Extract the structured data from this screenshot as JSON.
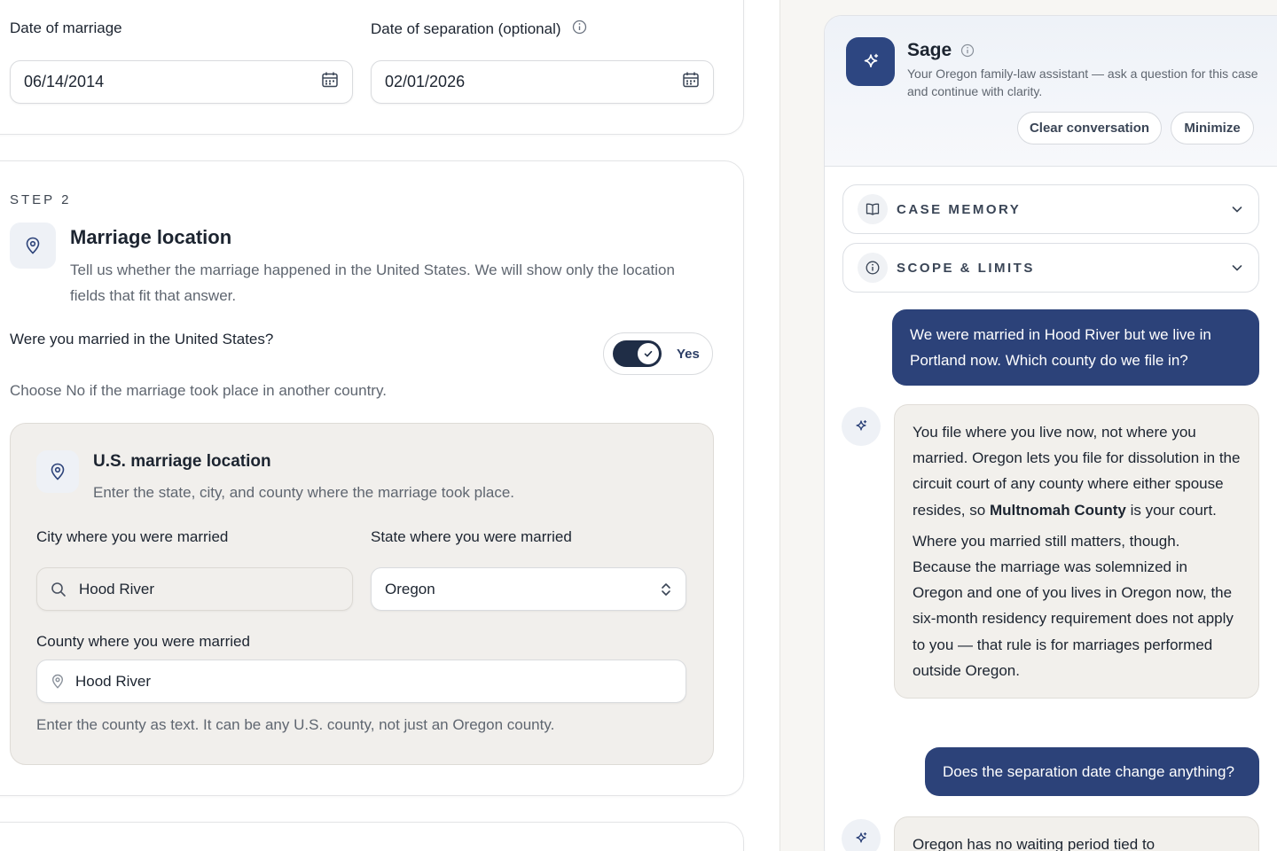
{
  "dates": {
    "marriage_label": "Date of marriage",
    "marriage_value": "06/14/2014",
    "separation_label": "Date of separation (optional)",
    "separation_value": "02/01/2026"
  },
  "step2": {
    "eyebrow": "STEP 2",
    "title": "Marriage location",
    "description": "Tell us whether the marriage happened in the United States. We will show only the location fields that fit that answer.",
    "question": "Were you married in the United States?",
    "toggle_label": "Yes",
    "toggle_on": true,
    "hint": "Choose No if the marriage took place in another country."
  },
  "us_location": {
    "title": "U.S. marriage location",
    "description": "Enter the state, city, and county where the marriage took place.",
    "city_label": "City where you were married",
    "city_value": "Hood River",
    "state_label": "State where you were married",
    "state_value": "Oregon",
    "county_label": "County where you were married",
    "county_value": "Hood River",
    "county_hint": "Enter the county as text. It can be any U.S. county, not just an Oregon county."
  },
  "assistant": {
    "name": "Sage",
    "subtitle": "Your Oregon family-law assistant — ask a question for this case and continue with clarity.",
    "clear_label": "Clear conversation",
    "minimize_label": "Minimize",
    "accordions": [
      {
        "label": "CASE MEMORY",
        "icon": "book-icon"
      },
      {
        "label": "SCOPE & LIMITS",
        "icon": "info-icon"
      }
    ],
    "messages": {
      "user1": "We were married in Hood River but we live in Portland now. Which county do we file in?",
      "ai1_p1_pre": "You file where you live now, not where you married. Oregon lets you file for dissolution in the circuit court of any county where either spouse resides, so ",
      "ai1_p1_bold": "Multnomah County",
      "ai1_p1_post": " is your court.",
      "ai1_p2": "Where you married still matters, though. Because the marriage was solemnized in Oregon and one of you lives in Oregon now, the six-month residency requirement does not apply to you — that rule is for marriages performed outside Oregon.",
      "user2": "Does the separation date change anything?",
      "ai2": "Oregon has no waiting period tied to"
    }
  },
  "colors": {
    "accent": "#2c4279",
    "panel_bg": "#f1efec",
    "toggle_track": "#1f2d46"
  }
}
